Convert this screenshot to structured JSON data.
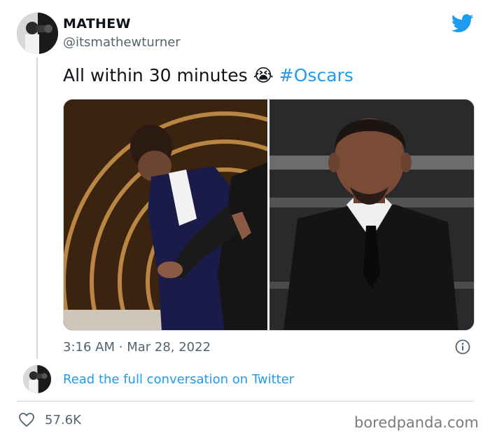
{
  "author": {
    "display_name": "MATHEW",
    "handle": "@itsmathewturner"
  },
  "tweet": {
    "text": "All within 30 minutes",
    "emoji": "😭",
    "hashtag": "#Oscars",
    "time": "3:16 AM",
    "separator": "·",
    "date": "Mar 28, 2022"
  },
  "media": {
    "left_photo": "slap-photo",
    "right_photo": "smiling-man-photo"
  },
  "footer": {
    "read_link": "Read the full conversation on Twitter",
    "likes": "57.6K"
  },
  "watermark": "boredpanda.com",
  "colors": {
    "twitter_blue": "#1d9bf0",
    "text_primary": "#0f1419",
    "text_secondary": "#536471",
    "border": "#cfd9de"
  },
  "icons": {
    "brand": "twitter-bird-icon",
    "info": "info-icon",
    "like": "heart-icon"
  }
}
